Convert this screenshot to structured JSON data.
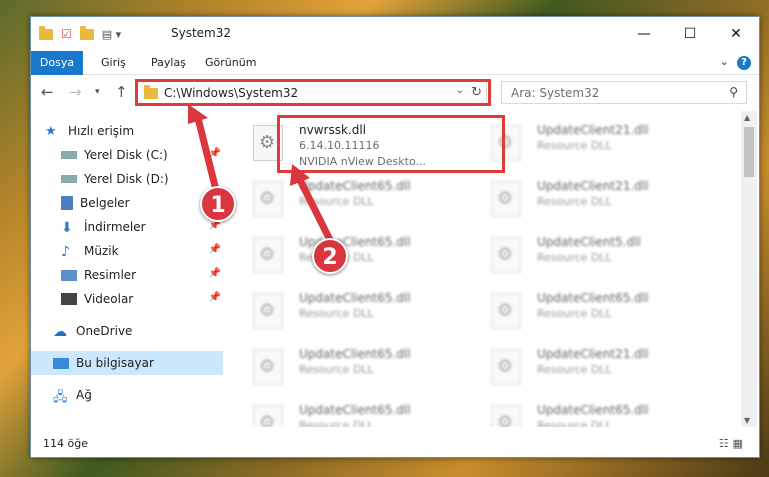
{
  "window": {
    "title": "System32"
  },
  "ribbon": {
    "tabs": [
      "Dosya",
      "Giriş",
      "Paylaş",
      "Görünüm"
    ]
  },
  "address": {
    "path": "C:\\Windows\\System32"
  },
  "search": {
    "placeholder": "Ara: System32"
  },
  "sidebar": {
    "items": [
      {
        "label": "Hızlı erişim",
        "icon": "star-icon"
      },
      {
        "label": "Yerel Disk (C:)",
        "icon": "drive-icon",
        "pinned": true
      },
      {
        "label": "Yerel Disk (D:)",
        "icon": "drive-icon"
      },
      {
        "label": "Belgeler",
        "icon": "documents-icon",
        "pinned": true
      },
      {
        "label": "İndirmeler",
        "icon": "download-icon",
        "pinned": true
      },
      {
        "label": "Müzik",
        "icon": "music-icon",
        "pinned": true
      },
      {
        "label": "Resimler",
        "icon": "pictures-icon",
        "pinned": true
      },
      {
        "label": "Videolar",
        "icon": "videos-icon",
        "pinned": true
      },
      {
        "label": "OneDrive",
        "icon": "cloud-icon"
      },
      {
        "label": "Bu bilgisayar",
        "icon": "computer-icon",
        "selected": true
      },
      {
        "label": "Ağ",
        "icon": "network-icon"
      }
    ]
  },
  "files": [
    {
      "name": "nvwrssk.dll",
      "line2": "6.14.10.11116",
      "line3": "NVIDIA nView Deskto..."
    },
    {
      "name": "UpdateClient21.dll",
      "line2": "Resource DLL"
    },
    {
      "name": "UpdateClient65.dll",
      "line2": "Resource DLL"
    },
    {
      "name": "UpdateClient21.dll",
      "line2": "Resource DLL"
    },
    {
      "name": "UpdateClient65.dll",
      "line2": "Resource DLL"
    },
    {
      "name": "UpdateClient5.dll",
      "line2": "Resource DLL"
    },
    {
      "name": "UpdateClient65.dll",
      "line2": "Resource DLL"
    },
    {
      "name": "UpdateClient65.dll",
      "line2": "Resource DLL"
    },
    {
      "name": "UpdateClient65.dll",
      "line2": "Resource DLL"
    },
    {
      "name": "UpdateClient21.dll",
      "line2": "Resource DLL"
    },
    {
      "name": "UpdateClient65.dll",
      "line2": "Resource DLL"
    },
    {
      "name": "UpdateClient65.dll",
      "line2": "Resource DLL"
    }
  ],
  "status": {
    "count": "114 öğe"
  },
  "annotations": {
    "step1": "1",
    "step2": "2",
    "color": "#d9363e"
  }
}
